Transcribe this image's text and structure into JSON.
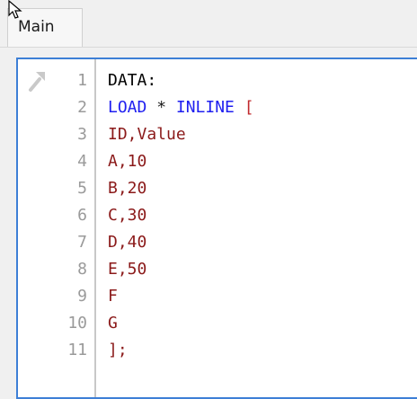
{
  "tabs": [
    {
      "label": "Main"
    }
  ],
  "editor": {
    "line_numbers": [
      "1",
      "2",
      "3",
      "4",
      "5",
      "6",
      "7",
      "8",
      "9",
      "10",
      "11"
    ],
    "lines": [
      [
        {
          "t": "DATA:",
          "c": "tx"
        }
      ],
      [
        {
          "t": "LOAD",
          "c": "kw"
        },
        {
          "t": " * ",
          "c": "op"
        },
        {
          "t": "INLINE",
          "c": "kw"
        },
        {
          "t": " [",
          "c": "br"
        }
      ],
      [
        {
          "t": "ID,Value",
          "c": "dt"
        }
      ],
      [
        {
          "t": "A,10",
          "c": "dt"
        }
      ],
      [
        {
          "t": "B,20",
          "c": "dt"
        }
      ],
      [
        {
          "t": "C,30",
          "c": "dt"
        }
      ],
      [
        {
          "t": "D,40",
          "c": "dt"
        }
      ],
      [
        {
          "t": "E,50",
          "c": "dt"
        }
      ],
      [
        {
          "t": "F",
          "c": "dt"
        }
      ],
      [
        {
          "t": "G",
          "c": "dt"
        }
      ],
      [
        {
          "t": "];",
          "c": "dt"
        }
      ]
    ]
  },
  "icons": {
    "gutter_icon": "pin-icon",
    "pointer": "mouse-cursor-icon"
  },
  "colors": {
    "keyword": "#1f1ff0",
    "data_text": "#8b1a1a",
    "bracket": "#c0282c",
    "editor_border": "#3d7fd6"
  }
}
